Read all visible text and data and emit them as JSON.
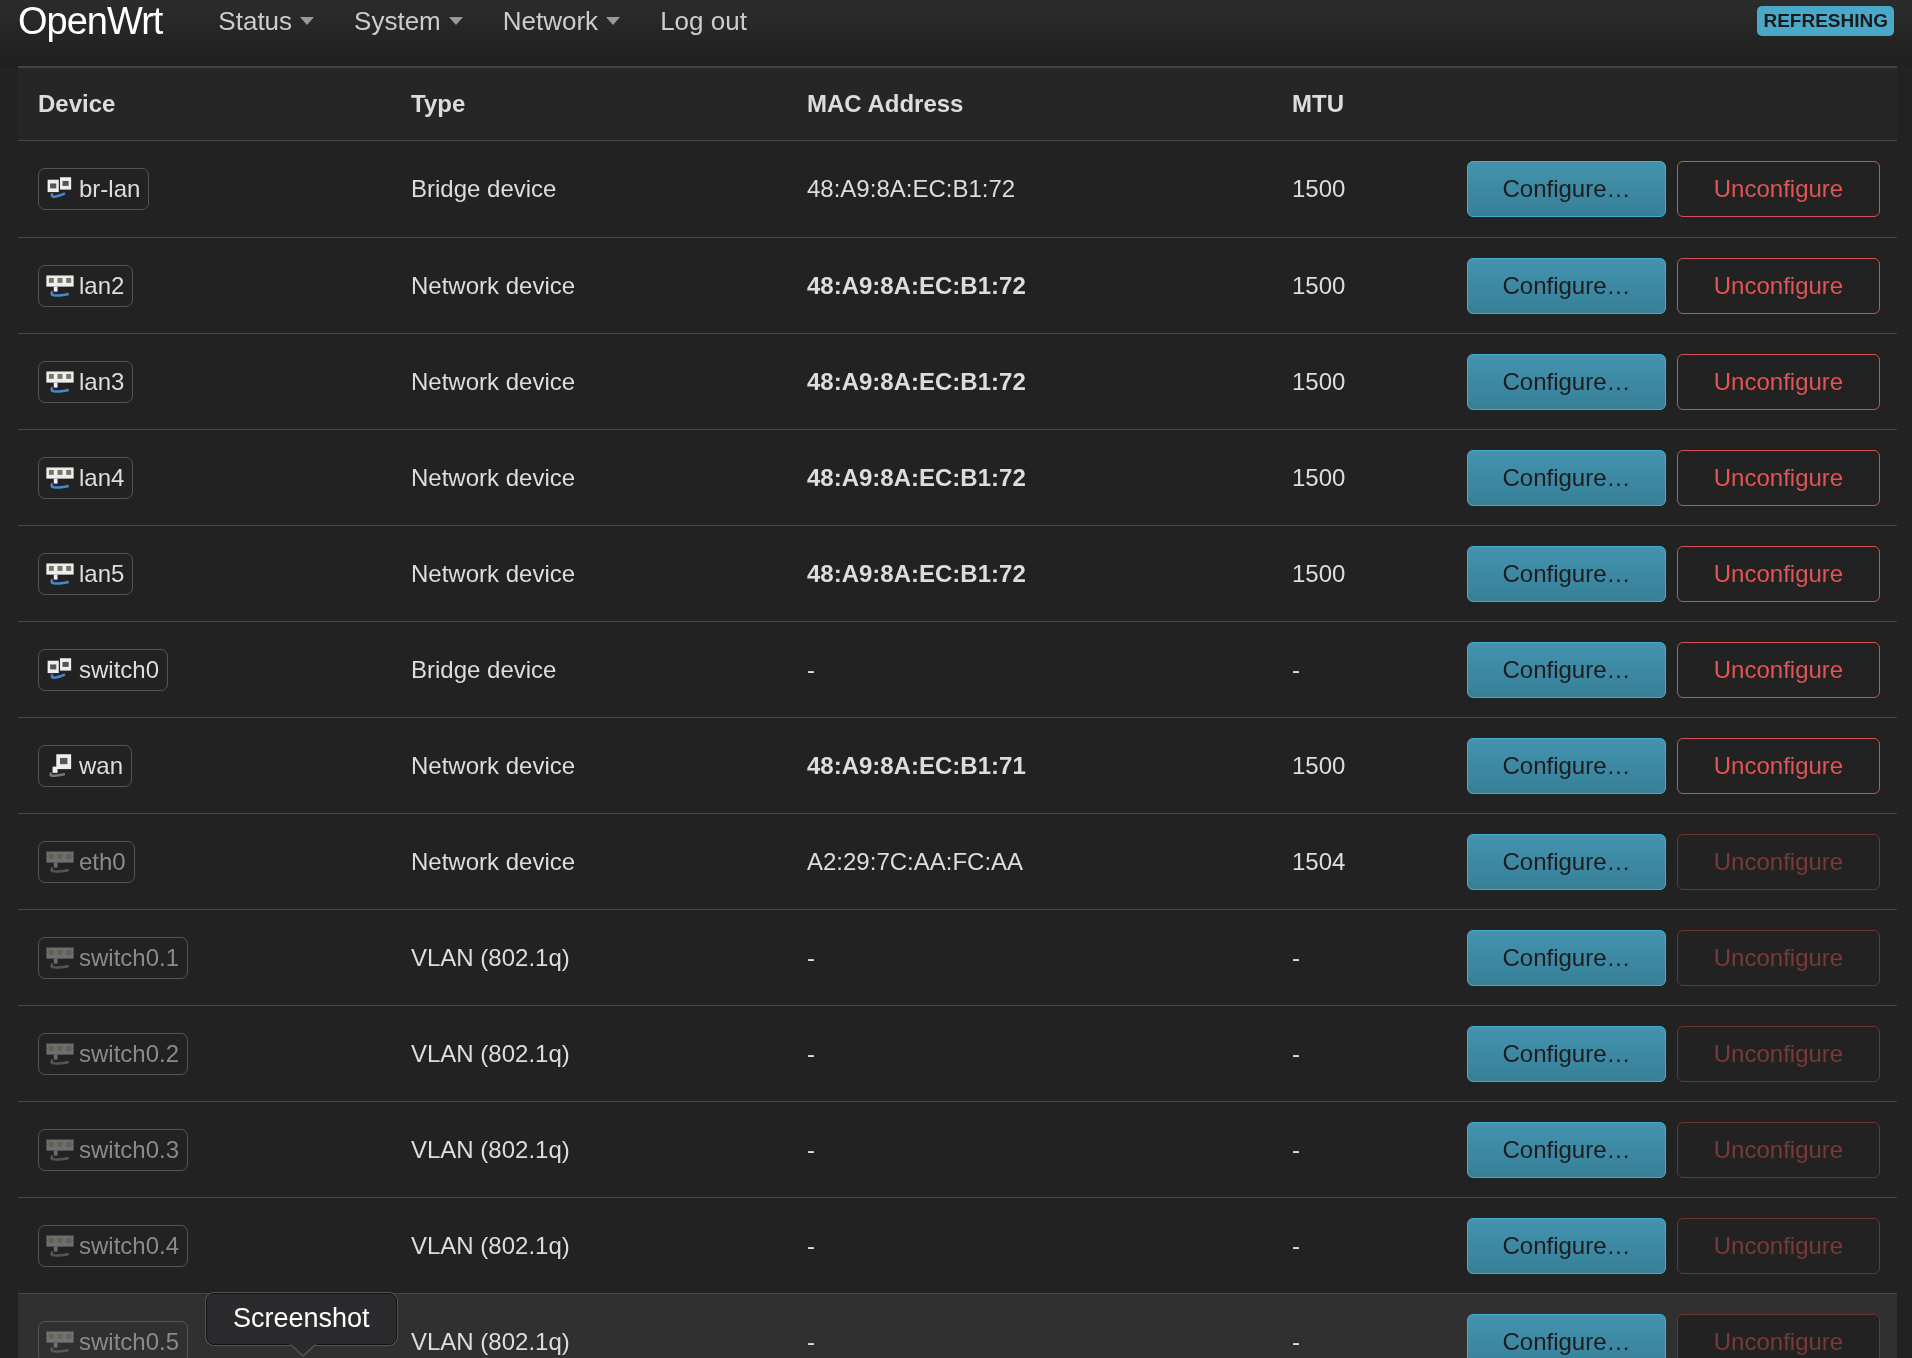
{
  "brand": "OpenWrt",
  "nav": [
    {
      "label": "Status",
      "dropdown": true
    },
    {
      "label": "System",
      "dropdown": true
    },
    {
      "label": "Network",
      "dropdown": true
    },
    {
      "label": "Log out",
      "dropdown": false
    }
  ],
  "status_badge": "REFRESHING",
  "table": {
    "columns": [
      "Device",
      "Type",
      "MAC Address",
      "MTU"
    ],
    "rows": [
      {
        "device": "br-lan",
        "kind": "bridge",
        "inactive": false,
        "type": "Bridge device",
        "mac": "48:A9:8A:EC:B1:72",
        "mac_bold": false,
        "mtu": "1500",
        "configure": "Configure…",
        "unconfigure": "Unconfigure",
        "unconfigure_disabled": false,
        "hovered": false
      },
      {
        "device": "lan2",
        "kind": "ethernet",
        "inactive": false,
        "type": "Network device",
        "mac": "48:A9:8A:EC:B1:72",
        "mac_bold": true,
        "mtu": "1500",
        "configure": "Configure…",
        "unconfigure": "Unconfigure",
        "unconfigure_disabled": false,
        "hovered": false
      },
      {
        "device": "lan3",
        "kind": "ethernet",
        "inactive": false,
        "type": "Network device",
        "mac": "48:A9:8A:EC:B1:72",
        "mac_bold": true,
        "mtu": "1500",
        "configure": "Configure…",
        "unconfigure": "Unconfigure",
        "unconfigure_disabled": false,
        "hovered": false
      },
      {
        "device": "lan4",
        "kind": "ethernet",
        "inactive": false,
        "type": "Network device",
        "mac": "48:A9:8A:EC:B1:72",
        "mac_bold": true,
        "mtu": "1500",
        "configure": "Configure…",
        "unconfigure": "Unconfigure",
        "unconfigure_disabled": false,
        "hovered": false
      },
      {
        "device": "lan5",
        "kind": "ethernet",
        "inactive": false,
        "type": "Network device",
        "mac": "48:A9:8A:EC:B1:72",
        "mac_bold": true,
        "mtu": "1500",
        "configure": "Configure…",
        "unconfigure": "Unconfigure",
        "unconfigure_disabled": false,
        "hovered": false
      },
      {
        "device": "switch0",
        "kind": "bridge",
        "inactive": false,
        "type": "Bridge device",
        "mac": "-",
        "mac_bold": false,
        "mtu": "-",
        "configure": "Configure…",
        "unconfigure": "Unconfigure",
        "unconfigure_disabled": false,
        "hovered": false
      },
      {
        "device": "wan",
        "kind": "port",
        "inactive": false,
        "type": "Network device",
        "mac": "48:A9:8A:EC:B1:71",
        "mac_bold": true,
        "mtu": "1500",
        "configure": "Configure…",
        "unconfigure": "Unconfigure",
        "unconfigure_disabled": false,
        "hovered": false
      },
      {
        "device": "eth0",
        "kind": "ethernet",
        "inactive": true,
        "type": "Network device",
        "mac": "A2:29:7C:AA:FC:AA",
        "mac_bold": false,
        "mtu": "1504",
        "configure": "Configure…",
        "unconfigure": "Unconfigure",
        "unconfigure_disabled": true,
        "hovered": false
      },
      {
        "device": "switch0.1",
        "kind": "ethernet",
        "inactive": true,
        "type": "VLAN (802.1q)",
        "mac": "-",
        "mac_bold": false,
        "mtu": "-",
        "configure": "Configure…",
        "unconfigure": "Unconfigure",
        "unconfigure_disabled": true,
        "hovered": false
      },
      {
        "device": "switch0.2",
        "kind": "ethernet",
        "inactive": true,
        "type": "VLAN (802.1q)",
        "mac": "-",
        "mac_bold": false,
        "mtu": "-",
        "configure": "Configure…",
        "unconfigure": "Unconfigure",
        "unconfigure_disabled": true,
        "hovered": false
      },
      {
        "device": "switch0.3",
        "kind": "ethernet",
        "inactive": true,
        "type": "VLAN (802.1q)",
        "mac": "-",
        "mac_bold": false,
        "mtu": "-",
        "configure": "Configure…",
        "unconfigure": "Unconfigure",
        "unconfigure_disabled": true,
        "hovered": false
      },
      {
        "device": "switch0.4",
        "kind": "ethernet",
        "inactive": true,
        "type": "VLAN (802.1q)",
        "mac": "-",
        "mac_bold": false,
        "mtu": "-",
        "configure": "Configure…",
        "unconfigure": "Unconfigure",
        "unconfigure_disabled": true,
        "hovered": false
      },
      {
        "device": "switch0.5",
        "kind": "ethernet",
        "inactive": true,
        "type": "VLAN (802.1q)",
        "mac": "-",
        "mac_bold": false,
        "mtu": "-",
        "configure": "Configure…",
        "unconfigure": "Unconfigure",
        "unconfigure_disabled": true,
        "hovered": true
      }
    ]
  },
  "tooltip": "Screenshot"
}
